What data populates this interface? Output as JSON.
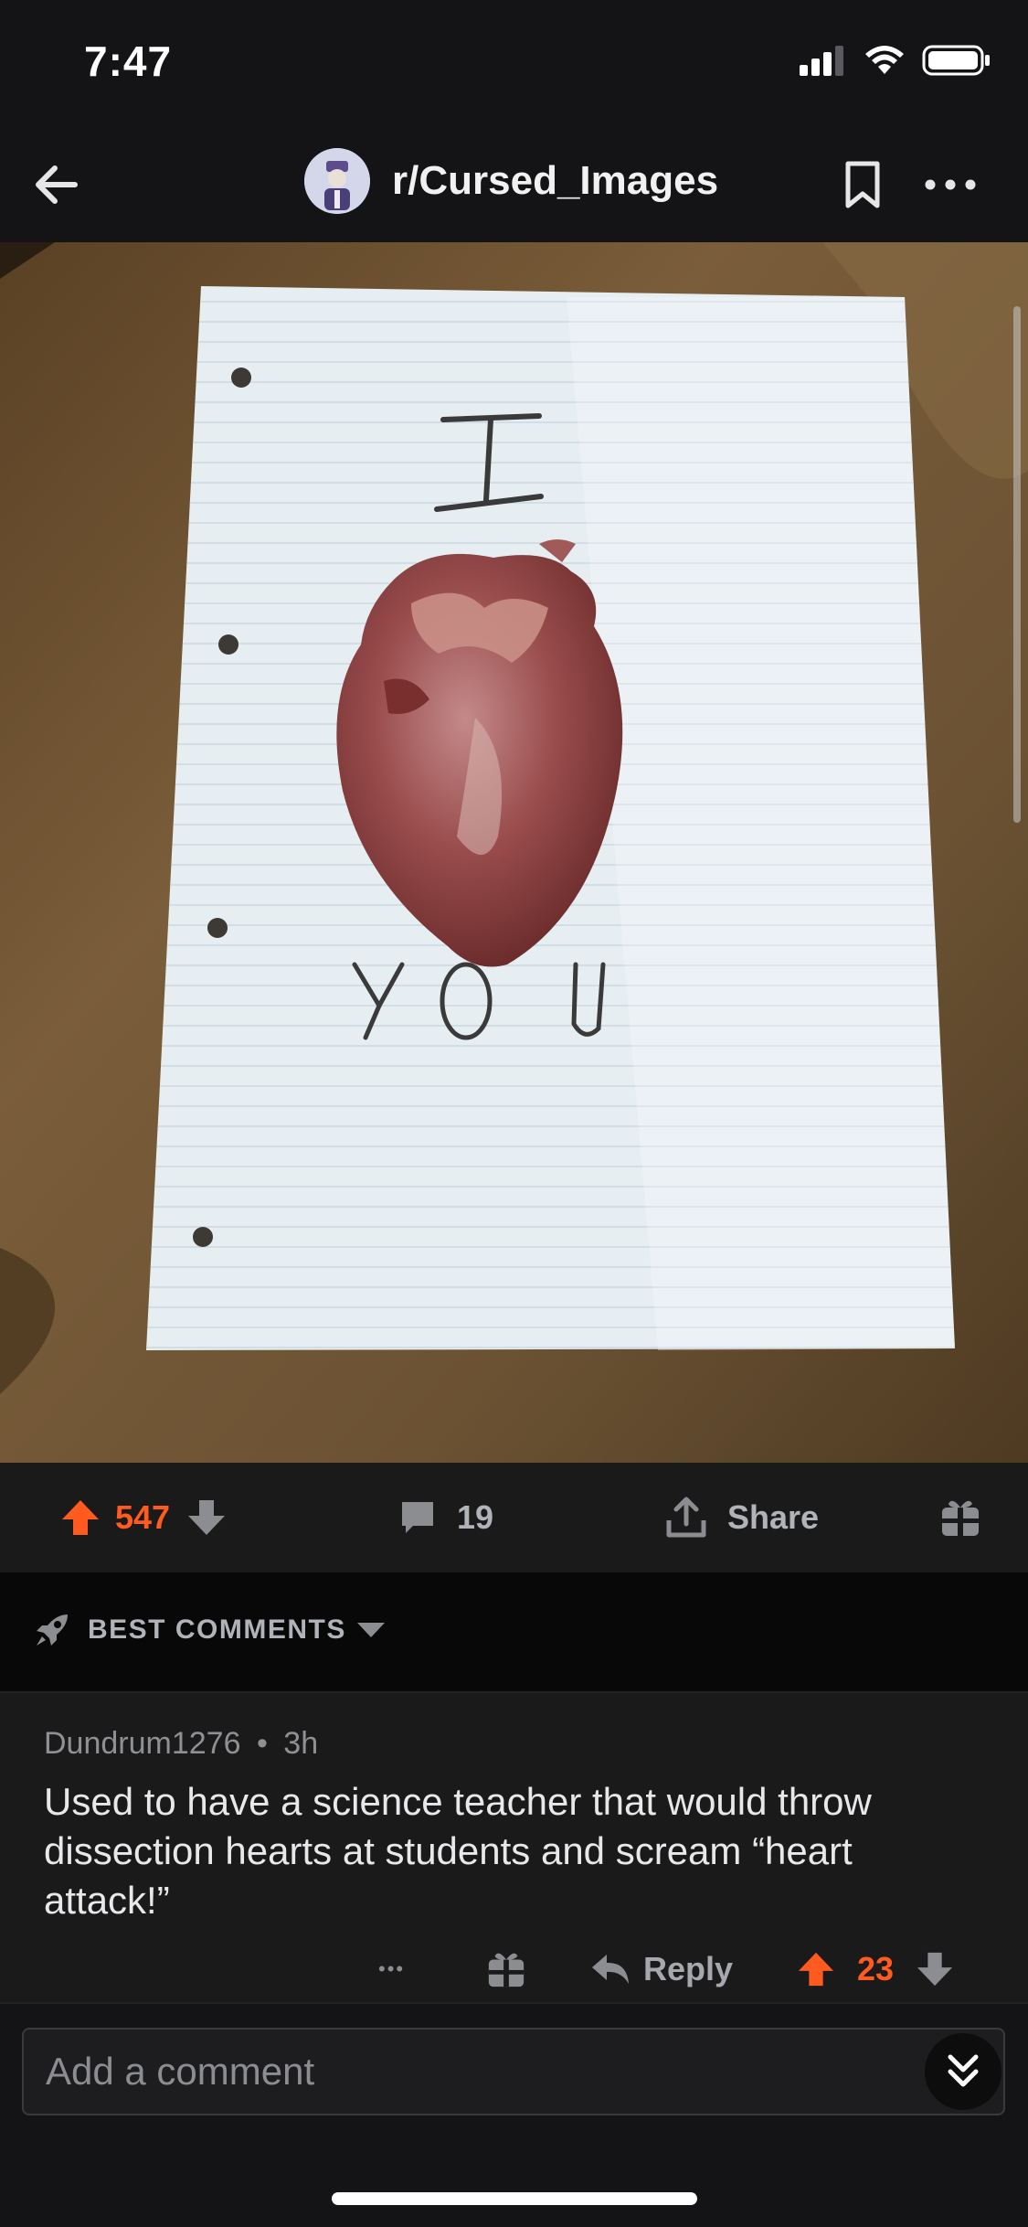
{
  "status_bar": {
    "time": "7:47"
  },
  "header": {
    "subreddit": "r/Cursed_Images"
  },
  "post": {
    "image_text": {
      "top_word": "I",
      "bottom_word": "YOU"
    }
  },
  "actions": {
    "upvotes": "547",
    "comments": "19",
    "share_label": "Share"
  },
  "sort": {
    "label": "BEST COMMENTS"
  },
  "comment": {
    "author": "Dundrum1276",
    "separator": "•",
    "age": "3h",
    "body": "Used to have a science teacher that would throw dissection hearts at students and scream “heart attack!”",
    "more": "•••",
    "reply_label": "Reply",
    "votes": "23"
  },
  "composer": {
    "placeholder": "Add a comment"
  },
  "colors": {
    "accent": "#ff5a1f",
    "background": "#141416",
    "surface": "#1a1a1b"
  },
  "icons": [
    "back-arrow-icon",
    "bookmark-icon",
    "more-icon",
    "upvote-icon",
    "downvote-icon",
    "comment-icon",
    "share-icon",
    "gift-icon",
    "rocket-icon",
    "chevron-down-icon",
    "reply-icon",
    "double-chevron-down-icon"
  ]
}
